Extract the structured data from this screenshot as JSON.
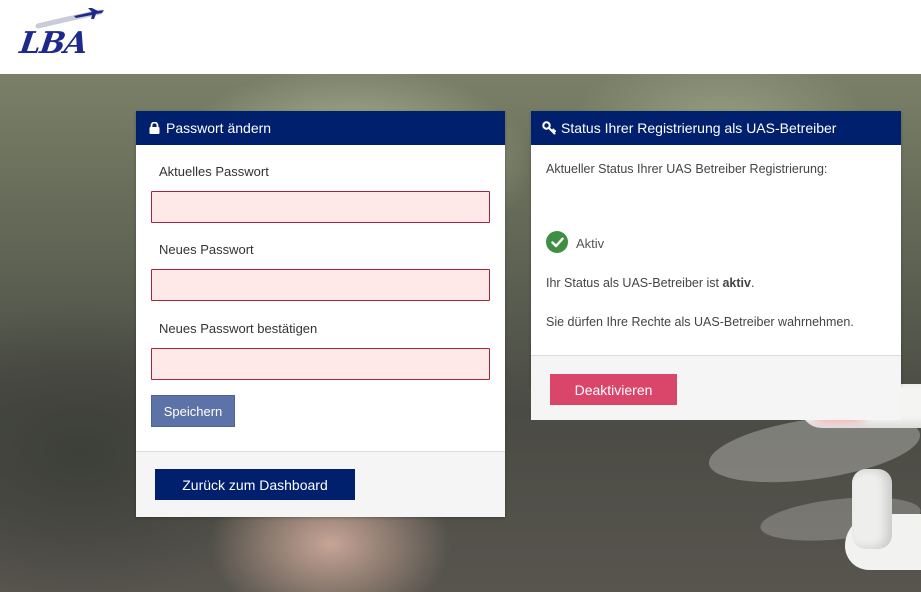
{
  "header": {
    "logo_text": "LBA"
  },
  "password_panel": {
    "title": "Passwort ändern",
    "icon": "lock-icon",
    "current_password_label": "Aktuelles Passwort",
    "current_password_value": "",
    "new_password_label": "Neues Passwort",
    "new_password_value": "",
    "confirm_password_label": "Neues Passwort bestätigen",
    "confirm_password_value": "",
    "save_label": "Speichern",
    "dashboard_label": "Zurück zum Dashboard"
  },
  "status_panel": {
    "title": "Status Ihrer Registrierung als UAS-Betreiber",
    "icon": "key-icon",
    "current_status_text": "Aktueller Status Ihrer UAS Betreiber Registrierung:",
    "status_value": "Aktiv",
    "status_line_prefix": "Ihr Status als UAS-Betreiber ist ",
    "status_line_bold": "aktiv",
    "status_line_suffix": ".",
    "rights_text": "Sie dürfen Ihre Rechte als UAS-Betreiber wahrnehmen.",
    "deactivate_label": "Deaktivieren"
  },
  "colors": {
    "header_blue": "#00206e",
    "input_error_border": "#a8243c",
    "input_error_bg": "#ffe8e8",
    "save_button": "#5d73a8",
    "deactivate_button": "#d9466a",
    "success_green": "#3e8f44"
  }
}
